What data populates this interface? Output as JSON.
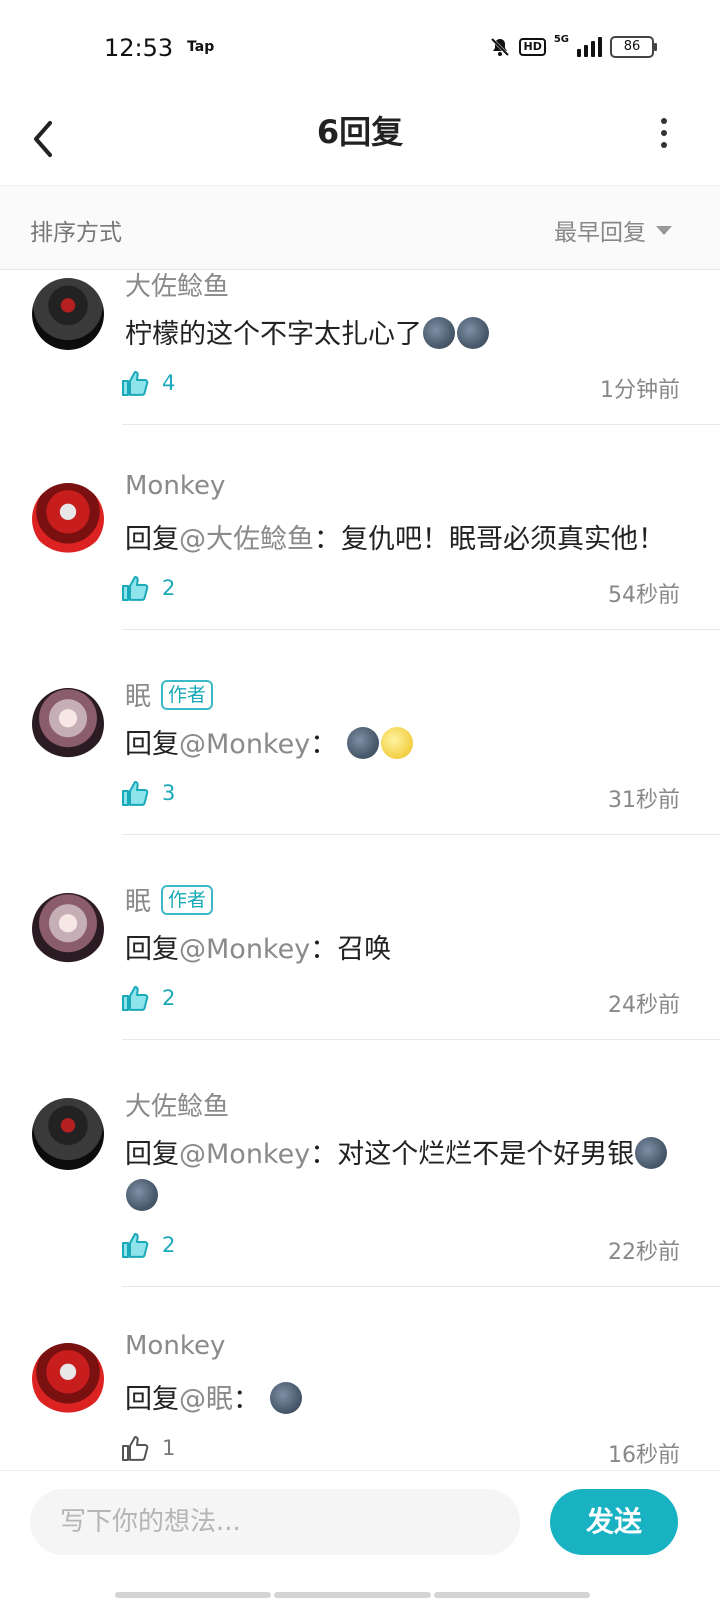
{
  "status_bar": {
    "time": "12:53",
    "app_tag": "Tap",
    "hd": "HD",
    "network": "5G",
    "battery": "86"
  },
  "header": {
    "title": "6回复"
  },
  "sort": {
    "label": "排序方式",
    "selected": "最早回复"
  },
  "comments": [
    {
      "name": "大佐鲶鱼",
      "badge": "",
      "mention": "",
      "text": "柠檬的这个不字太扎心了",
      "emojis": [
        "dark-moon-face",
        "dark-moon-face"
      ],
      "likes": "4",
      "liked": true,
      "time": "1分钟前"
    },
    {
      "name": "Monkey",
      "badge": "",
      "prefix": "回复",
      "mention": "@大佐鲶鱼",
      "sep": "：",
      "text": "复仇吧！眠哥必须真实他！",
      "likes": "2",
      "liked": true,
      "time": "54秒前"
    },
    {
      "name": "眠",
      "badge": "作者",
      "prefix": "回复",
      "mention": "@Monkey",
      "sep": "：",
      "text": "",
      "emojis": [
        "dark-moon-face",
        "yellow-moon-face"
      ],
      "likes": "3",
      "liked": true,
      "time": "31秒前"
    },
    {
      "name": "眠",
      "badge": "作者",
      "prefix": "回复",
      "mention": "@Monkey",
      "sep": "：",
      "text": "召唤",
      "likes": "2",
      "liked": true,
      "time": "24秒前"
    },
    {
      "name": "大佐鲶鱼",
      "badge": "",
      "prefix": "回复",
      "mention": "@Monkey",
      "sep": "：",
      "text": "对这个烂烂不是个好男银",
      "emojis": [
        "dark-moon-face",
        "dark-moon-face"
      ],
      "likes": "2",
      "liked": true,
      "time": "22秒前"
    },
    {
      "name": "Monkey",
      "badge": "",
      "prefix": "回复",
      "mention": "@眠",
      "sep": "：",
      "text": "",
      "emojis": [
        "dark-moon-face"
      ],
      "likes": "1",
      "liked": false,
      "time": "16秒前"
    }
  ],
  "composer": {
    "placeholder": "写下你的想法...",
    "send_label": "发送"
  },
  "colors": {
    "accent": "#18b2c2",
    "muted": "#8a8a8a"
  }
}
